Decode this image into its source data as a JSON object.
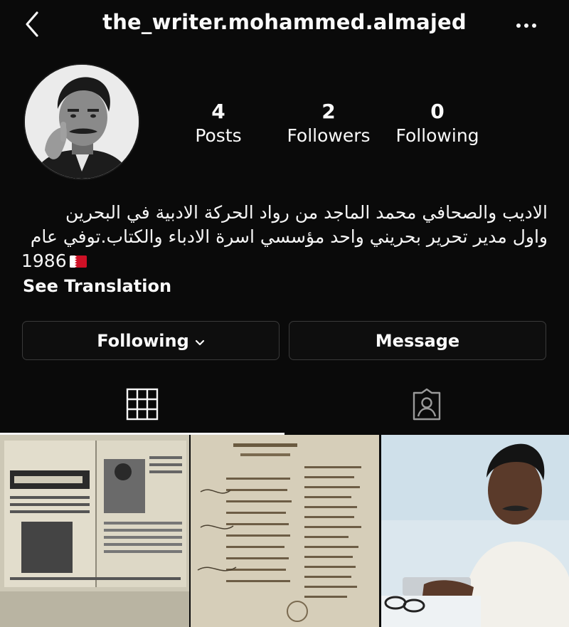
{
  "header": {
    "username": "the_writer.mohammed.almajed",
    "back_icon": "chevron-left-icon",
    "more_icon": "more-horizontal-icon"
  },
  "profile": {
    "avatar_icon": "profile-avatar",
    "stats": {
      "posts": {
        "count": "4",
        "label": "Posts"
      },
      "followers": {
        "count": "2",
        "label": "Followers"
      },
      "following": {
        "count": "0",
        "label": "Following"
      }
    },
    "bio": {
      "line1": "الاديب والصحافي محمد الماجد من رواد الحركة الادبية في البحرين",
      "line2": "واول مدير تحرير بحريني واحد مؤسسي اسرة الادباء والكتاب.توفي عام",
      "line3": "1986",
      "flag_icon": "bahrain-flag-icon"
    },
    "see_translation": "See Translation"
  },
  "actions": {
    "following_label": "Following",
    "message_label": "Message"
  },
  "tabs": {
    "grid_icon": "grid-icon",
    "tagged_icon": "tagged-user-icon"
  },
  "posts": [
    {
      "type": "magazine-clipping"
    },
    {
      "type": "document-list"
    },
    {
      "type": "portrait-photo"
    }
  ],
  "colors": {
    "background": "#0a0a0a",
    "text": "#fafafa",
    "button_border": "#3a3a3a",
    "flag_red": "#ce1126"
  }
}
